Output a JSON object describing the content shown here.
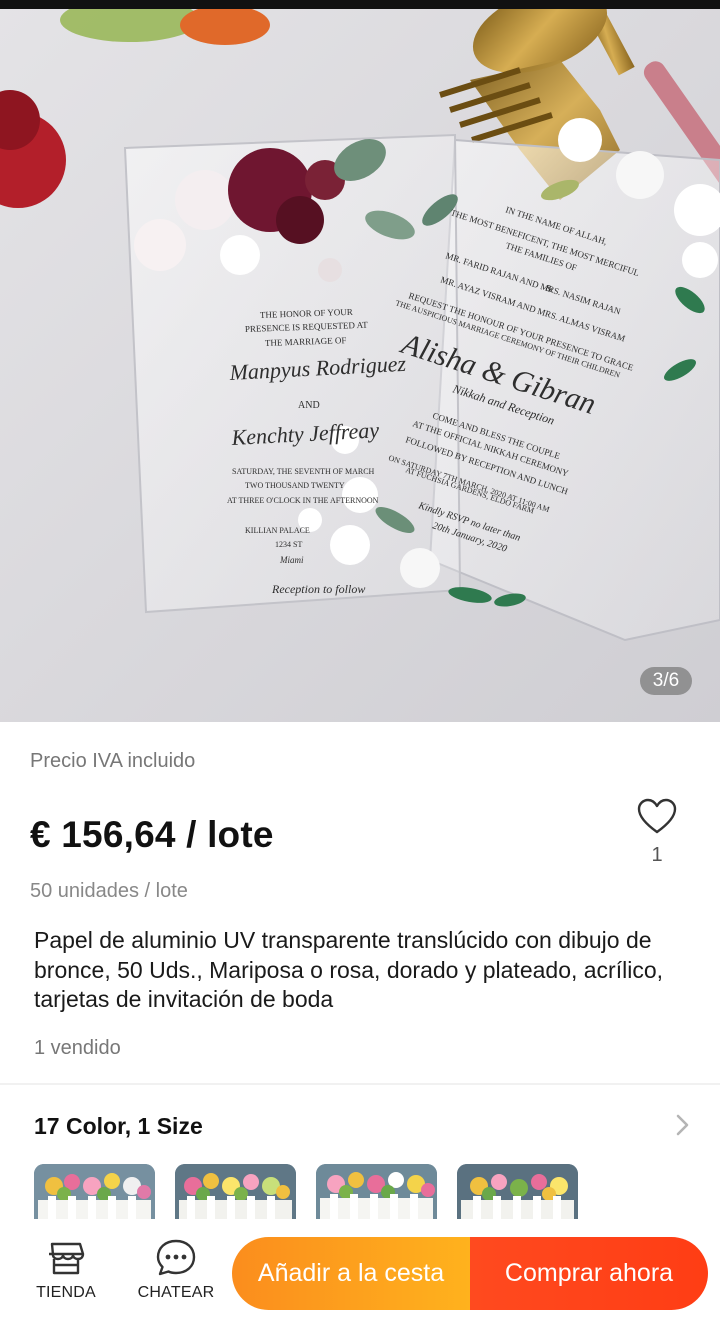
{
  "image": {
    "counter": "3/6",
    "card_text": {
      "front_invite_line1": "THE HONOR OF YOUR",
      "front_invite_line2": "PRESENCE IS REQUESTED AT",
      "front_invite_line3": "THE MARRIAGE OF",
      "front_name1": "Manpyus Rodriguez",
      "front_and": "AND",
      "front_name2": "Kenchty Jeffreay",
      "front_date": "SATURDAY, THE SEVENTH OF MARCH",
      "front_year": "TWO THOUSAND TWENTY",
      "front_time": "AT THREE O'CLOCK IN THE AFTERNOON",
      "front_venue": "KILLIAN PALACE",
      "front_addr": "1234 ST",
      "front_city": "Miami",
      "front_reception": "Reception to follow",
      "back_line1": "IN THE NAME OF ALLAH,",
      "back_line2": "THE MOST BENEFICENT, THE MOST MERCIFUL",
      "back_line3": "THE FAMILIES OF",
      "back_line4": "MR. FARID RAJAN AND MRS. NASIM RAJAN",
      "back_line5": "&",
      "back_line6": "MR. AYAZ VISRAM AND MRS. ALMAS VISRAM",
      "back_line7": "REQUEST THE HONOUR OF YOUR PRESENCE TO GRACE",
      "back_line8": "THE AUSPICIOUS MARRIAGE CEREMONY OF THEIR CHILDREN",
      "back_names": "Alisha & Gibran",
      "back_nikkah": "Nikkah and Reception",
      "back_come": "COME AND BLESS THE COUPLE",
      "back_official": "AT THE OFFICIAL NIKKAH CEREMONY",
      "back_followed": "FOLLOWED BY RECEPTION AND LUNCH",
      "back_date": "ON SATURDAY 7TH MARCH, 2020 AT 11:00 AM",
      "back_place": "AT FUCHSIA GARDENS, ELDO FARM",
      "back_rsvp": "Kindly RSVP no later than",
      "back_rsvp_date": "20th January, 2020"
    }
  },
  "product": {
    "vat_note": "Precio IVA incluido",
    "price": "€ 156,64 / lote",
    "units": "50 unidades / lote",
    "title": "Papel de aluminio UV transparente translúcido con dibujo de bronce, 50 Uds., Mariposa o rosa, dorado y plateado, acrílico, tarjetas de invitación de boda",
    "sold": "1 vendido",
    "wishlist_count": "1"
  },
  "variants": {
    "summary": "17 Color, 1 Size",
    "thumb_count": 4
  },
  "bottom_bar": {
    "store_label": "TIENDA",
    "chat_label": "CHATEAR",
    "add_to_cart": "Añadir a la cesta",
    "buy_now": "Comprar ahora"
  },
  "colors": {
    "add_to_cart_start": "#fb8d1d",
    "add_to_cart_end": "#ffb21d",
    "buy_now": "#ff4a1f",
    "price_text": "#111111",
    "muted_text": "#777777"
  },
  "icons": [
    "store-icon",
    "chat-icon",
    "heart-icon",
    "chevron-right-icon"
  ]
}
